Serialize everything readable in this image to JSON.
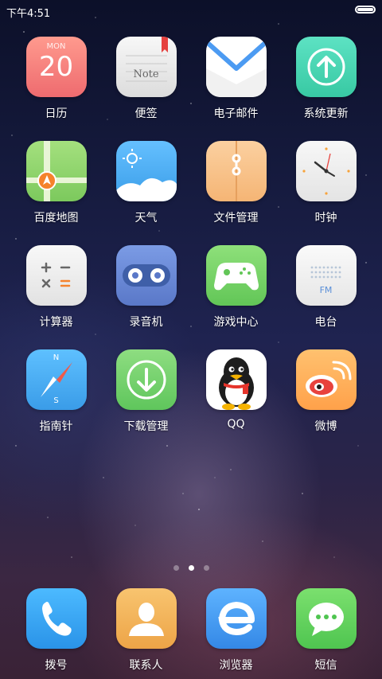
{
  "status_bar": {
    "time": "下午4:51",
    "battery_level": 1.0
  },
  "apps": [
    {
      "label": "日历",
      "icon": "calendar-icon",
      "day": "MON",
      "date": "20"
    },
    {
      "label": "便签",
      "icon": "notes-icon",
      "text": "Note"
    },
    {
      "label": "电子邮件",
      "icon": "email-icon"
    },
    {
      "label": "系统更新",
      "icon": "system-update-icon"
    },
    {
      "label": "百度地图",
      "icon": "baidu-maps-icon"
    },
    {
      "label": "天气",
      "icon": "weather-icon"
    },
    {
      "label": "文件管理",
      "icon": "file-manager-icon"
    },
    {
      "label": "时钟",
      "icon": "clock-icon"
    },
    {
      "label": "计算器",
      "icon": "calculator-icon"
    },
    {
      "label": "录音机",
      "icon": "recorder-icon"
    },
    {
      "label": "游戏中心",
      "icon": "game-center-icon"
    },
    {
      "label": "电台",
      "icon": "radio-icon",
      "text": "FM"
    },
    {
      "label": "指南针",
      "icon": "compass-icon",
      "north": "N",
      "south": "S"
    },
    {
      "label": "下载管理",
      "icon": "download-manager-icon"
    },
    {
      "label": "QQ",
      "icon": "qq-icon"
    },
    {
      "label": "微博",
      "icon": "weibo-icon"
    }
  ],
  "page_indicator": {
    "count": 3,
    "active": 2
  },
  "dock": [
    {
      "label": "拨号",
      "icon": "phone-icon"
    },
    {
      "label": "联系人",
      "icon": "contacts-icon"
    },
    {
      "label": "浏览器",
      "icon": "browser-icon"
    },
    {
      "label": "短信",
      "icon": "messages-icon"
    }
  ],
  "colors": {
    "calendar": "#f07a78",
    "update": "#47d6b2",
    "maps": "#8ed46a",
    "weather": "#5fb6f5",
    "file": "#f7c28a",
    "recorder": "#6f8fd8",
    "game": "#7fd86e",
    "compass": "#43a7ef",
    "download": "#79d278",
    "weibo": "#ffb35c",
    "phone": "#3aa8f2",
    "contacts": "#f3b55a",
    "browser": "#4ba4f2",
    "messages": "#6ad363"
  }
}
